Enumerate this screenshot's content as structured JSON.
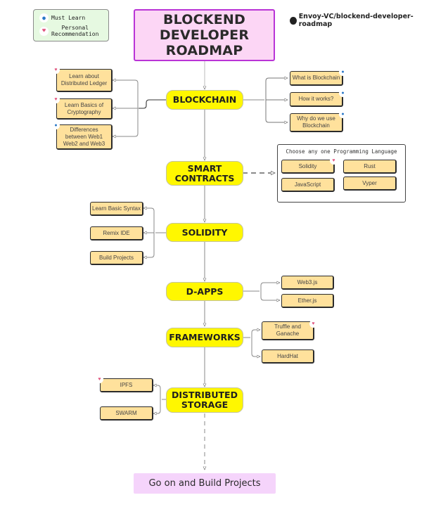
{
  "legend": {
    "items": [
      {
        "icon": "must-learn-ribbon-icon",
        "glyph": "🎖",
        "label": "Must Learn"
      },
      {
        "icon": "personal-recommendation-heart-icon",
        "glyph": "♥",
        "label": "Personal\nRecommendation"
      }
    ]
  },
  "title": "BLOCKEND\nDEVELOPER ROADMAP",
  "repo": {
    "icon": "github-icon",
    "label": "Envoy-VC/blockend-developer-roadmap"
  },
  "nodes": {
    "blockchain": {
      "label": "BLOCKCHAIN",
      "left": [
        {
          "label": "Learn about\nDistributed Ledger",
          "badge": "heart"
        },
        {
          "label": "Learn Basics of\nCryptography",
          "badge": "heart"
        },
        {
          "label": "Differences\nbetween Web1\nWeb2 and Web3",
          "badge": "ribbon"
        }
      ],
      "right": [
        {
          "label": "What is Blockchain",
          "badge": "ribbon"
        },
        {
          "label": "How it works?",
          "badge": "ribbon"
        },
        {
          "label": "Why do we use\nBlockchain",
          "badge": "ribbon"
        }
      ]
    },
    "smart_contracts": {
      "label": "SMART\nCONTRACTS",
      "language_box": {
        "caption": "Choose any one Programming Language",
        "options": [
          {
            "label": "Solidity",
            "badge": "heart"
          },
          {
            "label": "Rust",
            "badge": ""
          },
          {
            "label": "JavaScript",
            "badge": ""
          },
          {
            "label": "Vyper",
            "badge": ""
          }
        ]
      }
    },
    "solidity": {
      "label": "SOLIDITY",
      "left": [
        {
          "label": "Learn Basic Syntax"
        },
        {
          "label": "Remix IDE"
        },
        {
          "label": "Build Projects"
        }
      ]
    },
    "dapps": {
      "label": "D-APPS",
      "right": [
        {
          "label": "Web3.js"
        },
        {
          "label": "Ether.js"
        }
      ]
    },
    "frameworks": {
      "label": "FRAMEWORKS",
      "right": [
        {
          "label": "Truffle and\nGanache",
          "badge": "heart"
        },
        {
          "label": "HardHat"
        }
      ]
    },
    "storage": {
      "label": "DISTRIBUTED\nSTORAGE",
      "left": [
        {
          "label": "IPFS",
          "badge": "heart"
        },
        {
          "label": "SWARM"
        }
      ]
    }
  },
  "final": "Go on and Build Projects",
  "colors": {
    "main_node": "#fff700",
    "sub_node": "#ffe19c",
    "title_bg": "#fcd6f5",
    "title_border": "#b934d6",
    "final_bg": "#f5d4fb",
    "legend_bg": "#e6f9e1",
    "heart": "#e0557f",
    "ribbon": "#2a78c8"
  }
}
